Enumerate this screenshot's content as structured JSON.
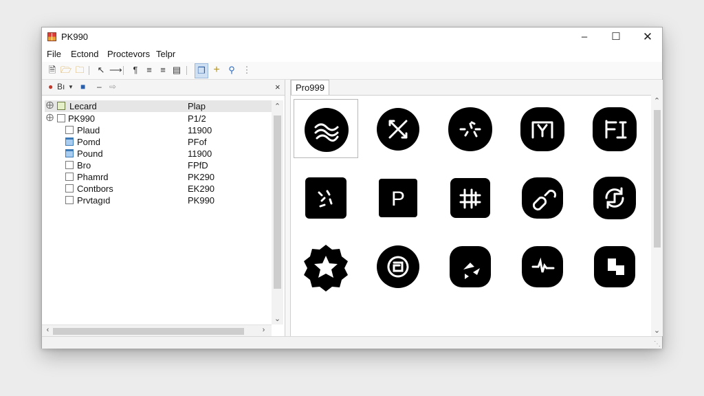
{
  "window": {
    "title": "PK990"
  },
  "menu": [
    "File",
    "Ectond",
    "Proctevors",
    "Telpr"
  ],
  "left_panel": {
    "toolbar_label": "Bı",
    "header": {
      "col1": "Lecard",
      "col2": "Plap"
    },
    "rows": [
      {
        "name": "PK990",
        "value": "P1/2"
      },
      {
        "name": "Plaud",
        "value": "11900"
      },
      {
        "name": "Pomd",
        "value": "PFof"
      },
      {
        "name": "Pound",
        "value": "11900"
      },
      {
        "name": "Bro",
        "value": "FPfD"
      },
      {
        "name": "Phamrd",
        "value": "PK290"
      },
      {
        "name": "Contbors",
        "value": "EK290"
      },
      {
        "name": "Prvtagıd",
        "value": "PK990"
      }
    ]
  },
  "right_panel": {
    "tab_label": "Pro999",
    "icons": [
      "waves-icon",
      "crossed-arrows-icon",
      "sparkle-dots-icon",
      "bracket-frame-icon",
      "circuit-frame-icon",
      "notebook-stars-icon",
      "letter-p-icon",
      "grid-hash-icon",
      "chain-link-icon",
      "refresh-circle-icon",
      "star-badge-icon",
      "spiral-maze-icon",
      "shapes-icon",
      "waveform-icon",
      "puzzle-block-icon",
      "shape-partial-icon-1",
      "shape-partial-icon-2",
      "shape-partial-icon-3",
      "shape-partial-icon-4",
      "shape-partial-icon-5"
    ]
  }
}
